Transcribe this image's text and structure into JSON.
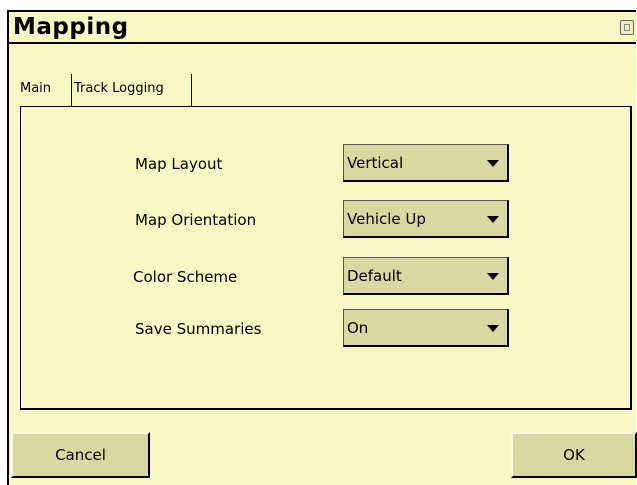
{
  "window": {
    "title": "Mapping"
  },
  "tabs": [
    {
      "label": "Main"
    },
    {
      "label": "Track Logging"
    }
  ],
  "settings": [
    {
      "label": "Map Layout",
      "value": "Vertical"
    },
    {
      "label": "Map Orientation",
      "value": "Vehicle Up"
    },
    {
      "label": "Color Scheme",
      "value": "Default"
    },
    {
      "label": "Save Summaries",
      "value": "On"
    }
  ],
  "buttons": {
    "cancel": "Cancel",
    "ok": "OK"
  },
  "colors": {
    "background": "#f8f8c4",
    "control": "#d8d8a0"
  },
  "icons": {
    "close": "close-icon",
    "dropdown": "chevron-down-icon"
  }
}
